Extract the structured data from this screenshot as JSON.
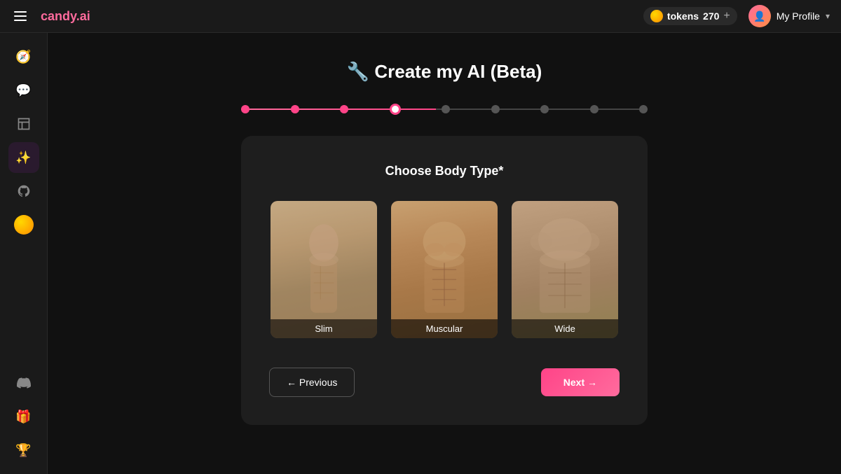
{
  "header": {
    "logo_text": "candy",
    "logo_suffix": ".ai",
    "tokens_label": "tokens",
    "tokens_count": "270",
    "tokens_add": "+",
    "profile_name": "My Profile",
    "profile_chevron": "▾"
  },
  "sidebar": {
    "top_items": [
      {
        "id": "compass",
        "icon": "🧭",
        "label": "explore"
      },
      {
        "id": "chat",
        "icon": "💬",
        "label": "chat"
      },
      {
        "id": "waves",
        "icon": "🌊",
        "label": "feed"
      },
      {
        "id": "star-magic",
        "icon": "✨",
        "label": "create",
        "active": true
      },
      {
        "id": "github",
        "icon": "🐙",
        "label": "github"
      }
    ],
    "coin_item": {
      "id": "coin",
      "label": "coins"
    },
    "bottom_items": [
      {
        "id": "discord",
        "icon": "🎮",
        "label": "discord"
      },
      {
        "id": "gift",
        "icon": "🎁",
        "label": "referral"
      },
      {
        "id": "trophy",
        "icon": "🏆",
        "label": "leaderboard"
      }
    ]
  },
  "page": {
    "title": "🔧 Create my AI (Beta)",
    "stepper": {
      "total_dots": 9,
      "filled_count": 3,
      "active_index": 3
    },
    "card": {
      "title": "Choose Body Type*",
      "body_options": [
        {
          "id": "slim",
          "label": "Slim"
        },
        {
          "id": "muscular",
          "label": "Muscular"
        },
        {
          "id": "wide",
          "label": "Wide"
        }
      ],
      "btn_prev": "← Previous",
      "btn_next": "Next →"
    }
  }
}
